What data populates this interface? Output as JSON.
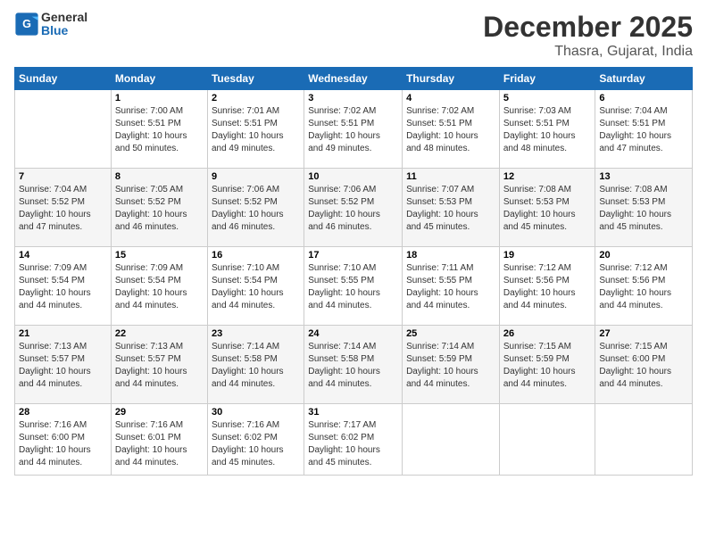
{
  "header": {
    "logo_text_general": "General",
    "logo_text_blue": "Blue",
    "month": "December 2025",
    "location": "Thasra, Gujarat, India"
  },
  "weekdays": [
    "Sunday",
    "Monday",
    "Tuesday",
    "Wednesday",
    "Thursday",
    "Friday",
    "Saturday"
  ],
  "weeks": [
    [
      {
        "day": "",
        "info": ""
      },
      {
        "day": "1",
        "info": "Sunrise: 7:00 AM\nSunset: 5:51 PM\nDaylight: 10 hours\nand 50 minutes."
      },
      {
        "day": "2",
        "info": "Sunrise: 7:01 AM\nSunset: 5:51 PM\nDaylight: 10 hours\nand 49 minutes."
      },
      {
        "day": "3",
        "info": "Sunrise: 7:02 AM\nSunset: 5:51 PM\nDaylight: 10 hours\nand 49 minutes."
      },
      {
        "day": "4",
        "info": "Sunrise: 7:02 AM\nSunset: 5:51 PM\nDaylight: 10 hours\nand 48 minutes."
      },
      {
        "day": "5",
        "info": "Sunrise: 7:03 AM\nSunset: 5:51 PM\nDaylight: 10 hours\nand 48 minutes."
      },
      {
        "day": "6",
        "info": "Sunrise: 7:04 AM\nSunset: 5:51 PM\nDaylight: 10 hours\nand 47 minutes."
      }
    ],
    [
      {
        "day": "7",
        "info": "Sunrise: 7:04 AM\nSunset: 5:52 PM\nDaylight: 10 hours\nand 47 minutes."
      },
      {
        "day": "8",
        "info": "Sunrise: 7:05 AM\nSunset: 5:52 PM\nDaylight: 10 hours\nand 46 minutes."
      },
      {
        "day": "9",
        "info": "Sunrise: 7:06 AM\nSunset: 5:52 PM\nDaylight: 10 hours\nand 46 minutes."
      },
      {
        "day": "10",
        "info": "Sunrise: 7:06 AM\nSunset: 5:52 PM\nDaylight: 10 hours\nand 46 minutes."
      },
      {
        "day": "11",
        "info": "Sunrise: 7:07 AM\nSunset: 5:53 PM\nDaylight: 10 hours\nand 45 minutes."
      },
      {
        "day": "12",
        "info": "Sunrise: 7:08 AM\nSunset: 5:53 PM\nDaylight: 10 hours\nand 45 minutes."
      },
      {
        "day": "13",
        "info": "Sunrise: 7:08 AM\nSunset: 5:53 PM\nDaylight: 10 hours\nand 45 minutes."
      }
    ],
    [
      {
        "day": "14",
        "info": "Sunrise: 7:09 AM\nSunset: 5:54 PM\nDaylight: 10 hours\nand 44 minutes."
      },
      {
        "day": "15",
        "info": "Sunrise: 7:09 AM\nSunset: 5:54 PM\nDaylight: 10 hours\nand 44 minutes."
      },
      {
        "day": "16",
        "info": "Sunrise: 7:10 AM\nSunset: 5:54 PM\nDaylight: 10 hours\nand 44 minutes."
      },
      {
        "day": "17",
        "info": "Sunrise: 7:10 AM\nSunset: 5:55 PM\nDaylight: 10 hours\nand 44 minutes."
      },
      {
        "day": "18",
        "info": "Sunrise: 7:11 AM\nSunset: 5:55 PM\nDaylight: 10 hours\nand 44 minutes."
      },
      {
        "day": "19",
        "info": "Sunrise: 7:12 AM\nSunset: 5:56 PM\nDaylight: 10 hours\nand 44 minutes."
      },
      {
        "day": "20",
        "info": "Sunrise: 7:12 AM\nSunset: 5:56 PM\nDaylight: 10 hours\nand 44 minutes."
      }
    ],
    [
      {
        "day": "21",
        "info": "Sunrise: 7:13 AM\nSunset: 5:57 PM\nDaylight: 10 hours\nand 44 minutes."
      },
      {
        "day": "22",
        "info": "Sunrise: 7:13 AM\nSunset: 5:57 PM\nDaylight: 10 hours\nand 44 minutes."
      },
      {
        "day": "23",
        "info": "Sunrise: 7:14 AM\nSunset: 5:58 PM\nDaylight: 10 hours\nand 44 minutes."
      },
      {
        "day": "24",
        "info": "Sunrise: 7:14 AM\nSunset: 5:58 PM\nDaylight: 10 hours\nand 44 minutes."
      },
      {
        "day": "25",
        "info": "Sunrise: 7:14 AM\nSunset: 5:59 PM\nDaylight: 10 hours\nand 44 minutes."
      },
      {
        "day": "26",
        "info": "Sunrise: 7:15 AM\nSunset: 5:59 PM\nDaylight: 10 hours\nand 44 minutes."
      },
      {
        "day": "27",
        "info": "Sunrise: 7:15 AM\nSunset: 6:00 PM\nDaylight: 10 hours\nand 44 minutes."
      }
    ],
    [
      {
        "day": "28",
        "info": "Sunrise: 7:16 AM\nSunset: 6:00 PM\nDaylight: 10 hours\nand 44 minutes."
      },
      {
        "day": "29",
        "info": "Sunrise: 7:16 AM\nSunset: 6:01 PM\nDaylight: 10 hours\nand 44 minutes."
      },
      {
        "day": "30",
        "info": "Sunrise: 7:16 AM\nSunset: 6:02 PM\nDaylight: 10 hours\nand 45 minutes."
      },
      {
        "day": "31",
        "info": "Sunrise: 7:17 AM\nSunset: 6:02 PM\nDaylight: 10 hours\nand 45 minutes."
      },
      {
        "day": "",
        "info": ""
      },
      {
        "day": "",
        "info": ""
      },
      {
        "day": "",
        "info": ""
      }
    ]
  ]
}
